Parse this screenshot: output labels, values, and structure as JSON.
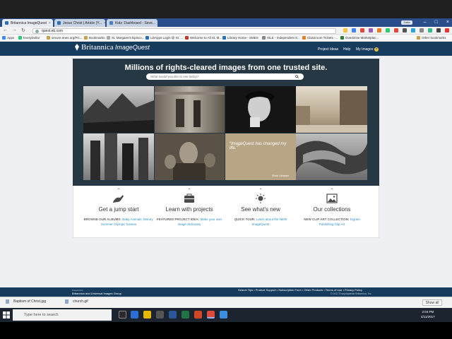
{
  "browser": {
    "tabs": [
      {
        "label": "Britannica ImageQuest"
      },
      {
        "label": "Jesus Christ | Article (Y..."
      },
      {
        "label": "Kidz: Dashboard - Seve..."
      }
    ],
    "user_badge": "Dalia",
    "url": "quest.eb.com",
    "bookmarks": [
      "Apps",
      "EveryDollar",
      "secure.enes.org/Pic...",
      "Bookmarks",
      "St. Margaret's Episco...",
      "LibApps Login @ St. ...",
      "Welcome to All St. M...",
      "Library Home - SMES",
      "ISLE - Independent S...",
      "Classroom Tickets -...",
      "OverDrive Marketplac...",
      "Other bookmarks"
    ]
  },
  "site": {
    "logo_brand": "Britannica",
    "logo_product": "ImageQuest",
    "nav": [
      "Project Ideas",
      "Help",
      "My Images"
    ],
    "hero_title": "Millions of rights-cleared images from one trusted site.",
    "search_placeholder": "What would you like to see today?",
    "quote_text": "“ImageQuest has changed my life.”",
    "quote_credit": "Photo Librarian",
    "features": [
      {
        "title": "Get a jump start",
        "label": "BROWSE OUR ALBUMS:",
        "text": "Baby Animals, Money, Summer Olympic Games",
        "icon": "kangaroo-icon"
      },
      {
        "title": "Learn with projects",
        "label": "FEATURED PROJECT IDEA:",
        "text": "Make your own image dictionary",
        "icon": "briefcase-icon"
      },
      {
        "title": "See what's new",
        "label": "QUICK TOUR:",
        "text": "Learn about the NEW ImageQuest",
        "icon": "sun-icon"
      },
      {
        "title": "Our collections",
        "label": "NEW CLIP ART COLLECTION:",
        "text": "Ingram Publishing Clip Art",
        "icon": "image-icon"
      }
    ],
    "footer_logo_line1": "Powered by",
    "footer_logo_line2": "Britannica and Universal Images Group",
    "footer_links": "Search Tips  •  Product Support  •  Subscription Form  •  Other Products  •  Terms of Use  •  Privacy Policy",
    "footer_copy": "© 2017 Encyclopædia Britannica, Inc."
  },
  "downloads": {
    "items": [
      "Baptism of Christ.jpg",
      "church.gif"
    ],
    "show_all": "Show all"
  },
  "taskbar": {
    "search_placeholder": "Type here to search",
    "time": "2:04 PM",
    "date": "4/11/2017"
  },
  "colors": {
    "site_nav": "#163b5c",
    "hero_bg": "#263843",
    "link": "#2a8fbf"
  }
}
